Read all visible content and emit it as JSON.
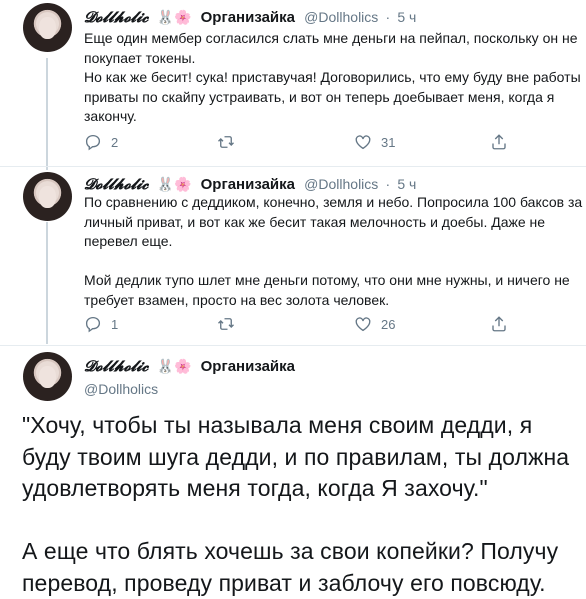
{
  "tweets": [
    {
      "display_name": "𝓓𝓸𝓵𝓵𝓱𝓸𝓵𝓲𝓬",
      "emoji": "🐰🌸",
      "org": "Организайка",
      "handle": "@Dollholics",
      "dot": "·",
      "time": "5 ч",
      "text": "Еще один мембер согласился слать мне деньги на пейпал, поскольку он не покупает токены.\nНо как же бесит! сука! приставучая!  Договорились, что ему буду вне работы приваты по скайпу устраивать, и вот он теперь доебывает меня, когда я закончу.",
      "replies": "2",
      "retweets": "",
      "likes": "31"
    },
    {
      "display_name": "𝓓𝓸𝓵𝓵𝓱𝓸𝓵𝓲𝓬",
      "emoji": "🐰🌸",
      "org": "Организайка",
      "handle": "@Dollholics",
      "dot": "·",
      "time": "5 ч",
      "text": "По сравнению с деддиком, конечно,  земля и небо. Попросила 100 баксов за личный приват, и вот как же бесит такая мелочность и доебы. Даже не перевел еще.\n\nМой дедлик тупо шлет мне деньги потому, что они мне нужны, и ничего не требует взамен, просто на вес золота человек.",
      "replies": "1",
      "retweets": "",
      "likes": "26"
    }
  ],
  "main_tweet": {
    "display_name": "𝓓𝓸𝓵𝓵𝓱𝓸𝓵𝓲𝓬",
    "emoji": "🐰🌸",
    "org": "Организайка",
    "handle": "@Dollholics",
    "text": "\"Хочу, чтобы ты называла меня своим дедди, я буду твоим шуга дедди, и по правилам, ты должна удовлетворять меня тогда, когда Я захочу.\"\n\nА  еще что блять хочешь за свои копейки? Получу перевод, проведу приват и заблочу его повсюду."
  },
  "icons": {
    "reply": "reply-icon",
    "retweet": "retweet-icon",
    "like": "heart-icon",
    "share": "share-icon"
  },
  "colors": {
    "text": "#14171a",
    "secondary": "#657786",
    "divider": "#e6ecf0",
    "thread_line": "#ccd6dd"
  }
}
